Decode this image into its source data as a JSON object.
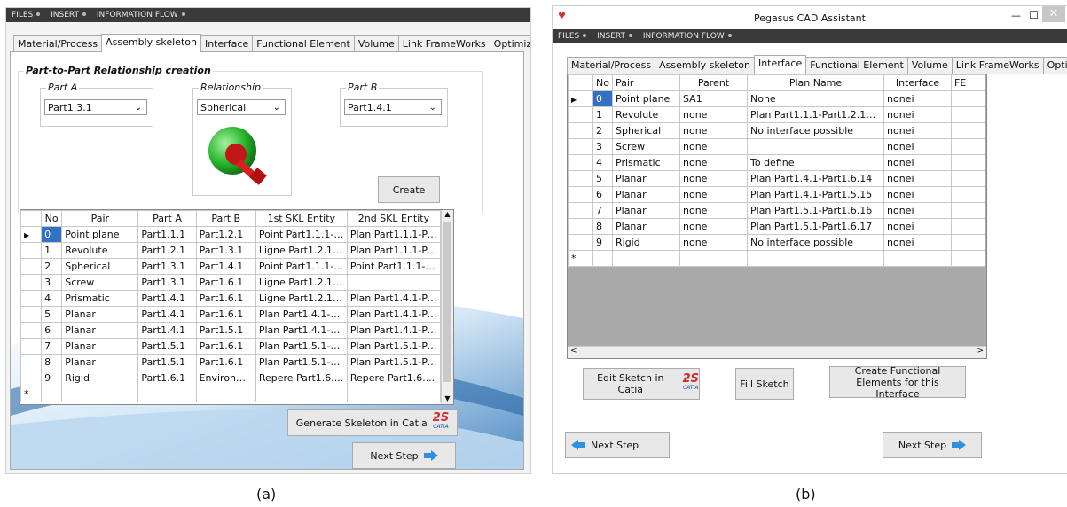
{
  "left": {
    "menu": [
      "FILES",
      "INSERT",
      "INFORMATION FLOW"
    ],
    "tabs": [
      "Material/Process",
      "Assembly skeleton",
      "Interface",
      "Functional Element",
      "Volume",
      "Link FrameWorks",
      "Optimization"
    ],
    "group_title": "Part-to-Part Relationship creation",
    "part_a_label": "Part A",
    "part_a_value": "Part1.3.1",
    "relationship_label": "Relationship",
    "relationship_value": "Spherical",
    "part_b_label": "Part B",
    "part_b_value": "Part1.4.1",
    "create_label": "Create",
    "columns": [
      "No",
      "Pair",
      "Part A",
      "Part B",
      "1st SKL Entity",
      "2nd SKL Entity"
    ],
    "rows": [
      [
        "0",
        "Point plane",
        "Part1.1.1",
        "Part1.2.1",
        "Point Part1.1.1-P...",
        "Plan Part1.1.1-Pa..."
      ],
      [
        "1",
        "Revolute",
        "Part1.2.1",
        "Part1.3.1",
        "Ligne Part1.2.1-P...",
        "Plan Part1.1.1-Pa..."
      ],
      [
        "2",
        "Spherical",
        "Part1.3.1",
        "Part1.4.1",
        "Point Part1.1.1-P...",
        "Point Part1.1.1-P..."
      ],
      [
        "3",
        "Screw",
        "Part1.3.1",
        "Part1.6.1",
        "Ligne Part1.2.1-P...",
        ""
      ],
      [
        "4",
        "Prismatic",
        "Part1.4.1",
        "Part1.6.1",
        "Ligne Part1.2.1-P...",
        "Plan Part1.4.1-Pa..."
      ],
      [
        "5",
        "Planar",
        "Part1.4.1",
        "Part1.6.1",
        "Plan Part1.4.1-Pa...",
        "Plan Part1.4.1-Pa..."
      ],
      [
        "6",
        "Planar",
        "Part1.4.1",
        "Part1.5.1",
        "Plan Part1.4.1-Pa...",
        "Plan Part1.4.1-Pa..."
      ],
      [
        "7",
        "Planar",
        "Part1.5.1",
        "Part1.6.1",
        "Plan Part1.5.1-Pa...",
        "Plan Part1.5.1-Pa..."
      ],
      [
        "8",
        "Planar",
        "Part1.5.1",
        "Part1.6.1",
        "Plan Part1.5.1-Pa...",
        "Plan Part1.5.1-Pa..."
      ],
      [
        "9",
        "Rigid",
        "Part1.6.1",
        "Environm...",
        "Repere Part1.6....",
        "Repere Part1.6...."
      ]
    ],
    "generate_label": "Generate Skeleton in Catia",
    "next_label": "Next Step"
  },
  "right": {
    "title": "Pegasus CAD Assistant",
    "menu": [
      "FILES",
      "INSERT",
      "INFORMATION FLOW"
    ],
    "tabs": [
      "Material/Process",
      "Assembly skeleton",
      "Interface",
      "Functional Element",
      "Volume",
      "Link FrameWorks",
      "Optimization"
    ],
    "columns": [
      "No",
      "Pair",
      "Parent",
      "Plan Name",
      "Interface",
      "FE"
    ],
    "rows": [
      [
        "0",
        "Point plane",
        "SA1",
        "None",
        "nonei",
        ""
      ],
      [
        "1",
        "Revolute",
        "none",
        "Plan Part1.1.1-Part1.2.11-Part1....",
        "nonei",
        ""
      ],
      [
        "2",
        "Spherical",
        "none",
        "No interface possible",
        "nonei",
        ""
      ],
      [
        "3",
        "Screw",
        "none",
        "",
        "nonei",
        ""
      ],
      [
        "4",
        "Prismatic",
        "none",
        "To define",
        "nonei",
        ""
      ],
      [
        "5",
        "Planar",
        "none",
        "Plan Part1.4.1-Part1.6.14",
        "nonei",
        ""
      ],
      [
        "6",
        "Planar",
        "none",
        "Plan Part1.4.1-Part1.5.15",
        "nonei",
        ""
      ],
      [
        "7",
        "Planar",
        "none",
        "Plan Part1.5.1-Part1.6.16",
        "nonei",
        ""
      ],
      [
        "8",
        "Planar",
        "none",
        "Plan Part1.5.1-Part1.6.17",
        "nonei",
        ""
      ],
      [
        "9",
        "Rigid",
        "none",
        "No interface possible",
        "nonei",
        ""
      ]
    ],
    "edit_sketch_label": "Edit Sketch in Catia",
    "fill_sketch_label": "Fill Sketch",
    "create_fe_label": "Create Functional Elements for this Interface",
    "prev_label": "Next Step",
    "next_label": "Next Step"
  },
  "catia_logo_text": "CATIA",
  "captions": [
    "(a)",
    "(b)"
  ],
  "colors": {
    "selection": "#3271c4",
    "menubar": "#3a3a3a",
    "arrow": "#2f8fe0"
  }
}
